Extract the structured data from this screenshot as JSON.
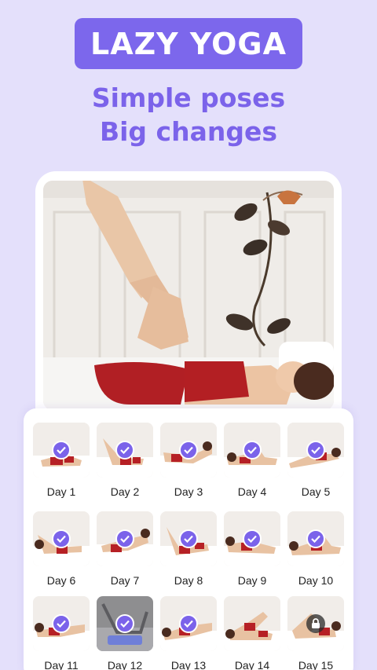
{
  "header": {
    "badge": "LAZY YOGA",
    "tagline_line1": "Simple poses",
    "tagline_line2": "Big changes"
  },
  "colors": {
    "background": "#e4e0fb",
    "accent": "#7c67ec",
    "tagline": "#7b63ea"
  },
  "hero": {
    "image": "woman-lying-leg-stretch-photo"
  },
  "days": [
    {
      "label": "Day 1",
      "status": "completed"
    },
    {
      "label": "Day 2",
      "status": "completed"
    },
    {
      "label": "Day 3",
      "status": "completed"
    },
    {
      "label": "Day 4",
      "status": "completed"
    },
    {
      "label": "Day 5",
      "status": "completed"
    },
    {
      "label": "Day 6",
      "status": "completed"
    },
    {
      "label": "Day 7",
      "status": "completed"
    },
    {
      "label": "Day 8",
      "status": "completed"
    },
    {
      "label": "Day 9",
      "status": "completed"
    },
    {
      "label": "Day 10",
      "status": "completed"
    },
    {
      "label": "Day 11",
      "status": "completed"
    },
    {
      "label": "Day 12",
      "status": "completed"
    },
    {
      "label": "Day 13",
      "status": "completed"
    },
    {
      "label": "Day 14",
      "status": "open"
    },
    {
      "label": "Day 15",
      "status": "locked"
    }
  ]
}
